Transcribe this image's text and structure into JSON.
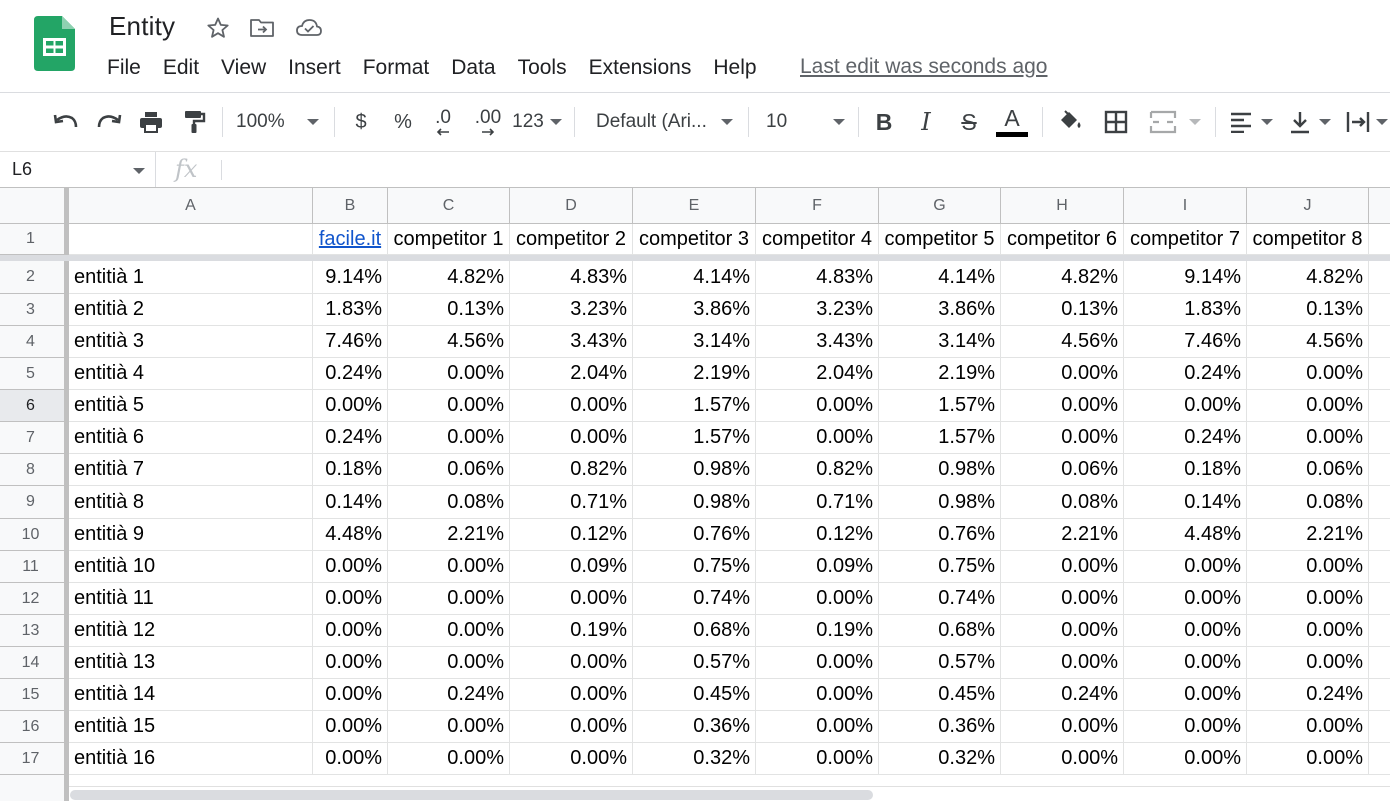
{
  "doc": {
    "title": "Entity",
    "last_edit": "Last edit was seconds ago"
  },
  "icons": {
    "logo": "google-sheets-logo",
    "star": "star-icon",
    "move": "move-to-folder-icon",
    "cloud": "cloud-status-icon"
  },
  "menu": [
    "File",
    "Edit",
    "View",
    "Insert",
    "Format",
    "Data",
    "Tools",
    "Extensions",
    "Help"
  ],
  "toolbar": {
    "zoom": "100%",
    "currency": "$",
    "percent": "%",
    "decrease_decimals": ".0",
    "increase_decimals": ".00",
    "more_formats": "123",
    "font": "Default (Ari...",
    "font_size": "10",
    "bold": "B",
    "italic": "I",
    "strikethrough": "S",
    "text_color_letter": "A"
  },
  "formula_bar": {
    "name_box": "L6",
    "fx": "fx",
    "formula": ""
  },
  "grid": {
    "columns": [
      "A",
      "B",
      "C",
      "D",
      "E",
      "F",
      "G",
      "H",
      "I",
      "J"
    ],
    "header_row": {
      "row_number": "1",
      "cells": [
        "",
        "facile.it",
        "competitor 1",
        "competitor 2",
        "competitor 3",
        "competitor 4",
        "competitor 5",
        "competitor 6",
        "competitor 7",
        "competitor 8"
      ]
    },
    "active_row": "6",
    "rows": [
      {
        "n": "2",
        "cells": [
          "entitià 1",
          "9.14%",
          "4.82%",
          "4.83%",
          "4.14%",
          "4.83%",
          "4.14%",
          "4.82%",
          "9.14%",
          "4.82%"
        ]
      },
      {
        "n": "3",
        "cells": [
          "entitià 2",
          "1.83%",
          "0.13%",
          "3.23%",
          "3.86%",
          "3.23%",
          "3.86%",
          "0.13%",
          "1.83%",
          "0.13%"
        ]
      },
      {
        "n": "4",
        "cells": [
          "entitià 3",
          "7.46%",
          "4.56%",
          "3.43%",
          "3.14%",
          "3.43%",
          "3.14%",
          "4.56%",
          "7.46%",
          "4.56%"
        ]
      },
      {
        "n": "5",
        "cells": [
          "entitià 4",
          "0.24%",
          "0.00%",
          "2.04%",
          "2.19%",
          "2.04%",
          "2.19%",
          "0.00%",
          "0.24%",
          "0.00%"
        ]
      },
      {
        "n": "6",
        "cells": [
          "entitià 5",
          "0.00%",
          "0.00%",
          "0.00%",
          "1.57%",
          "0.00%",
          "1.57%",
          "0.00%",
          "0.00%",
          "0.00%"
        ]
      },
      {
        "n": "7",
        "cells": [
          "entitià 6",
          "0.24%",
          "0.00%",
          "0.00%",
          "1.57%",
          "0.00%",
          "1.57%",
          "0.00%",
          "0.24%",
          "0.00%"
        ]
      },
      {
        "n": "8",
        "cells": [
          "entitià 7",
          "0.18%",
          "0.06%",
          "0.82%",
          "0.98%",
          "0.82%",
          "0.98%",
          "0.06%",
          "0.18%",
          "0.06%"
        ]
      },
      {
        "n": "9",
        "cells": [
          "entitià 8",
          "0.14%",
          "0.08%",
          "0.71%",
          "0.98%",
          "0.71%",
          "0.98%",
          "0.08%",
          "0.14%",
          "0.08%"
        ]
      },
      {
        "n": "10",
        "cells": [
          "entitià 9",
          "4.48%",
          "2.21%",
          "0.12%",
          "0.76%",
          "0.12%",
          "0.76%",
          "2.21%",
          "4.48%",
          "2.21%"
        ]
      },
      {
        "n": "11",
        "cells": [
          "entitià 10",
          "0.00%",
          "0.00%",
          "0.09%",
          "0.75%",
          "0.09%",
          "0.75%",
          "0.00%",
          "0.00%",
          "0.00%"
        ]
      },
      {
        "n": "12",
        "cells": [
          "entitià 11",
          "0.00%",
          "0.00%",
          "0.00%",
          "0.74%",
          "0.00%",
          "0.74%",
          "0.00%",
          "0.00%",
          "0.00%"
        ]
      },
      {
        "n": "13",
        "cells": [
          "entitià 12",
          "0.00%",
          "0.00%",
          "0.19%",
          "0.68%",
          "0.19%",
          "0.68%",
          "0.00%",
          "0.00%",
          "0.00%"
        ]
      },
      {
        "n": "14",
        "cells": [
          "entitià 13",
          "0.00%",
          "0.00%",
          "0.00%",
          "0.57%",
          "0.00%",
          "0.57%",
          "0.00%",
          "0.00%",
          "0.00%"
        ]
      },
      {
        "n": "15",
        "cells": [
          "entitià 14",
          "0.00%",
          "0.24%",
          "0.00%",
          "0.45%",
          "0.00%",
          "0.45%",
          "0.24%",
          "0.00%",
          "0.24%"
        ]
      },
      {
        "n": "16",
        "cells": [
          "entitià 15",
          "0.00%",
          "0.00%",
          "0.00%",
          "0.36%",
          "0.00%",
          "0.36%",
          "0.00%",
          "0.00%",
          "0.00%"
        ]
      },
      {
        "n": "17",
        "cells": [
          "entitià 16",
          "0.00%",
          "0.00%",
          "0.00%",
          "0.32%",
          "0.00%",
          "0.32%",
          "0.00%",
          "0.00%",
          "0.00%"
        ]
      }
    ]
  },
  "colors": {
    "sheets_green": "#23a566",
    "link_blue": "#1155cc",
    "header_bg": "#f8f9fa"
  }
}
